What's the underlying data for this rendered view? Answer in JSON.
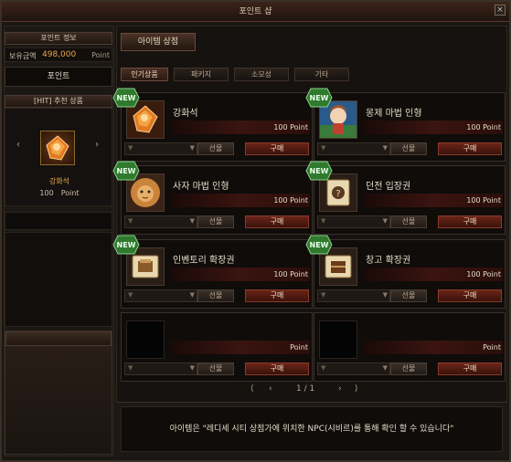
{
  "window": {
    "title": "포인트 샵",
    "close_label": "×"
  },
  "left": {
    "point_info_header": "포인트 정보",
    "balance_label": "보유금액",
    "balance_value": "498,000",
    "balance_unit": "Point",
    "point_button": "포인트",
    "recommend_header": "[HIT] 추천 상품",
    "recommend_item_name": "강화석",
    "recommend_item_price": "100",
    "recommend_item_unit": "Point",
    "prev_arrow": "‹",
    "next_arrow": "›"
  },
  "shop": {
    "tab_label": "아이템 상점",
    "subtabs": [
      "인기상품",
      "패키지",
      "소모성",
      "기타"
    ],
    "active_subtab": 0,
    "items": [
      {
        "name": "강화석",
        "price": "100 Point",
        "new": "NEW",
        "gift": "선물",
        "buy": "구매",
        "icon": "orange-gem-icon"
      },
      {
        "name": "몽제 마법 인형",
        "price": "100 Point",
        "new": "NEW",
        "gift": "선물",
        "buy": "구매",
        "icon": "doll-icon"
      },
      {
        "name": "사자 마법 인형",
        "price": "100 Point",
        "new": "NEW",
        "gift": "선물",
        "buy": "구매",
        "icon": "lion-icon"
      },
      {
        "name": "던전 입장권",
        "price": "100 Point",
        "new": "NEW",
        "gift": "선물",
        "buy": "구매",
        "icon": "scroll-icon"
      },
      {
        "name": "인벤토리 확장권",
        "price": "100 Point",
        "new": "NEW",
        "gift": "선물",
        "buy": "구매",
        "icon": "inventory-ticket-icon"
      },
      {
        "name": "창고 확장권",
        "price": "100 Point",
        "new": "NEW",
        "gift": "선물",
        "buy": "구매",
        "icon": "storage-ticket-icon"
      },
      {
        "name": "",
        "price": "Point",
        "gift": "선물",
        "buy": "구매"
      },
      {
        "name": "",
        "price": "Point",
        "gift": "선물",
        "buy": "구매"
      }
    ],
    "pager": {
      "first": "⟨",
      "prev": "‹",
      "page": "1 / 1",
      "next": "›",
      "last": "⟩"
    },
    "notice": "아이템은 \"레디세 시티 상점가에 위치한 NPC(시비르)를 통해 확인 할 수 있습니다\""
  },
  "colors": {
    "accent": "#e8a648",
    "buy": "#6a2418",
    "new_badge": "#2f7a2f"
  }
}
